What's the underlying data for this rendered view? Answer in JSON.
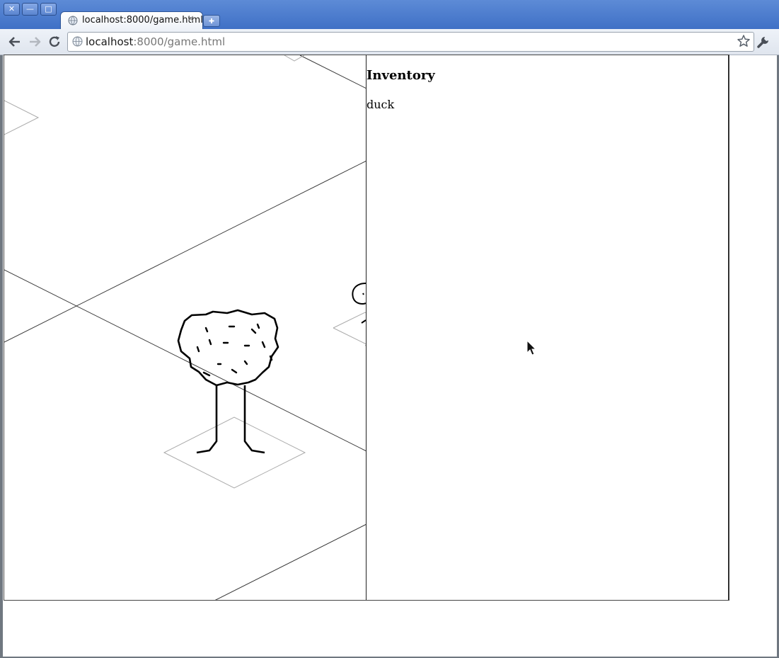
{
  "window": {
    "controls": {
      "close": "✕",
      "minimize": "—",
      "maximize": "□"
    }
  },
  "tabs": [
    {
      "title": "localhost:8000/game.html",
      "active": true
    }
  ],
  "toolbar": {
    "url_host": "localhost",
    "url_rest": ":8000/game.html"
  },
  "game": {
    "scene_objects": [
      "tree",
      "stick-figure"
    ]
  },
  "inventory": {
    "title": "Inventory",
    "items": [
      "duck"
    ]
  },
  "colors": {
    "titlebar": "#4a7bcf",
    "panel_border": "#222222",
    "grid_line": "#333333",
    "tile_outline": "#aaaaaa"
  }
}
